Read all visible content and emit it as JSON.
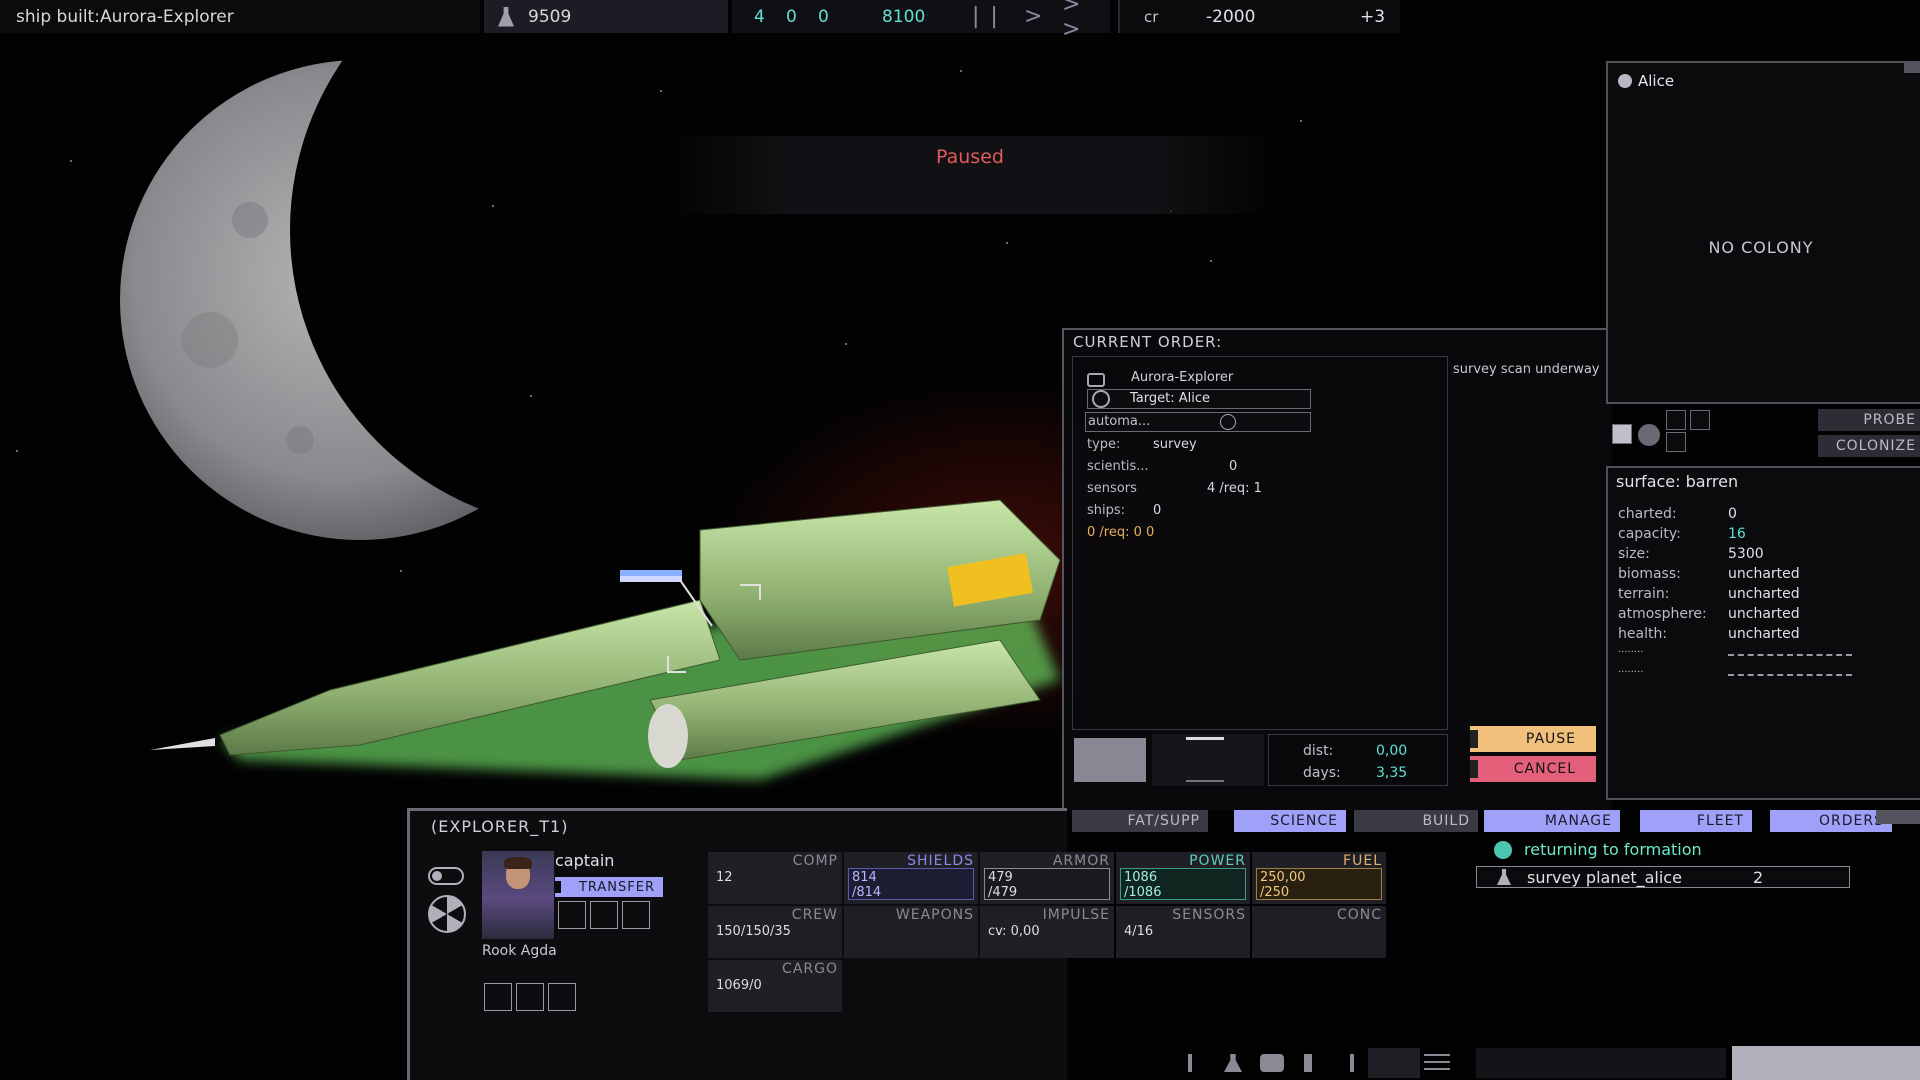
{
  "topbar": {
    "ship_built": "ship built:Aurora-Explorer",
    "science_points": "9509",
    "date_a": "4",
    "date_b": "0",
    "date_c": "0",
    "year": "8100",
    "speed_pause": "| |",
    "speed_play": ">",
    "speed_fast": "> >",
    "credits_label": "cr",
    "credits_value": "-2000",
    "credits_delta": "+3"
  },
  "paused_text": "Paused",
  "order": {
    "title": "CURRENT ORDER:",
    "ship": "Aurora-Explorer",
    "target": "Target: Alice",
    "automation": "automa...",
    "type_label": "type:",
    "type_value": "survey",
    "scientists_label": "scientis...",
    "scientists_value": "0",
    "sensors_label": "sensors",
    "sensors_value": "4 /req: 1",
    "ships_label": "ships:",
    "ships_value": "0",
    "req_line": "0 /req: 0 0",
    "status": "survey scan underway",
    "dist_label": "dist:",
    "dist_value": "0,00",
    "days_label": "days:",
    "days_value": "3,35",
    "pause_button": "PAUSE",
    "cancel_button": "CANCEL"
  },
  "planet": {
    "name": "Alice",
    "colony_status": "NO COLONY",
    "probe_button": "PROBE",
    "colonize_button": "COLONIZE",
    "surface_title": "surface: barren",
    "rows": [
      {
        "label": "charted:",
        "value": "0"
      },
      {
        "label": "capacity:",
        "value": "16"
      },
      {
        "label": "size:",
        "value": "5300"
      },
      {
        "label": "biomass:",
        "value": "uncharted"
      },
      {
        "label": "terrain:",
        "value": "uncharted"
      },
      {
        "label": "atmosphere:",
        "value": "uncharted"
      },
      {
        "label": "health:",
        "value": "uncharted"
      },
      {
        "label": "........",
        "value": ""
      },
      {
        "label": "........",
        "value": ""
      }
    ]
  },
  "tabs": {
    "fat": "FAT/SUPP",
    "science": "SCIENCE",
    "build": "BUILD",
    "manage": "MANAGE",
    "fleet": "FLEET",
    "orders": "ORDERS"
  },
  "queue": {
    "item1": "returning to formation",
    "item2": "survey planet_alice",
    "item2_count": "2"
  },
  "ship": {
    "class": "(EXPLORER_T1)",
    "captain_label": "captain",
    "transfer_button": "TRANSFER",
    "captain_name": "Rook Agda",
    "stats": {
      "comp_label": "COMP",
      "comp_value": "12",
      "shields_label": "SHIELDS",
      "shields_value": "814",
      "shields_max": "/814",
      "armor_label": "ARMOR",
      "armor_value": "479",
      "armor_max": "/479",
      "power_label": "POWER",
      "power_value": "1086",
      "power_max": "/1086",
      "fuel_label": "FUEL",
      "fuel_value": "250,00",
      "fuel_max": "/250",
      "crew_label": "CREW",
      "crew_value": "150/150/35",
      "weapons_label": "WEAPONS",
      "impulse_label": "IMPULSE",
      "impulse_value": "cv: 0,00",
      "sensors_label": "SENSORS",
      "sensors_value": "4/16",
      "conc_label": "CONC",
      "cargo_label": "CARGO",
      "cargo_value": "1069/0"
    }
  },
  "colors": {
    "accent": "#9fa0f7",
    "pause": "#f0c07c",
    "cancel": "#e45f7a",
    "teal": "#60e0d0",
    "paused_red": "#e25b5b"
  }
}
